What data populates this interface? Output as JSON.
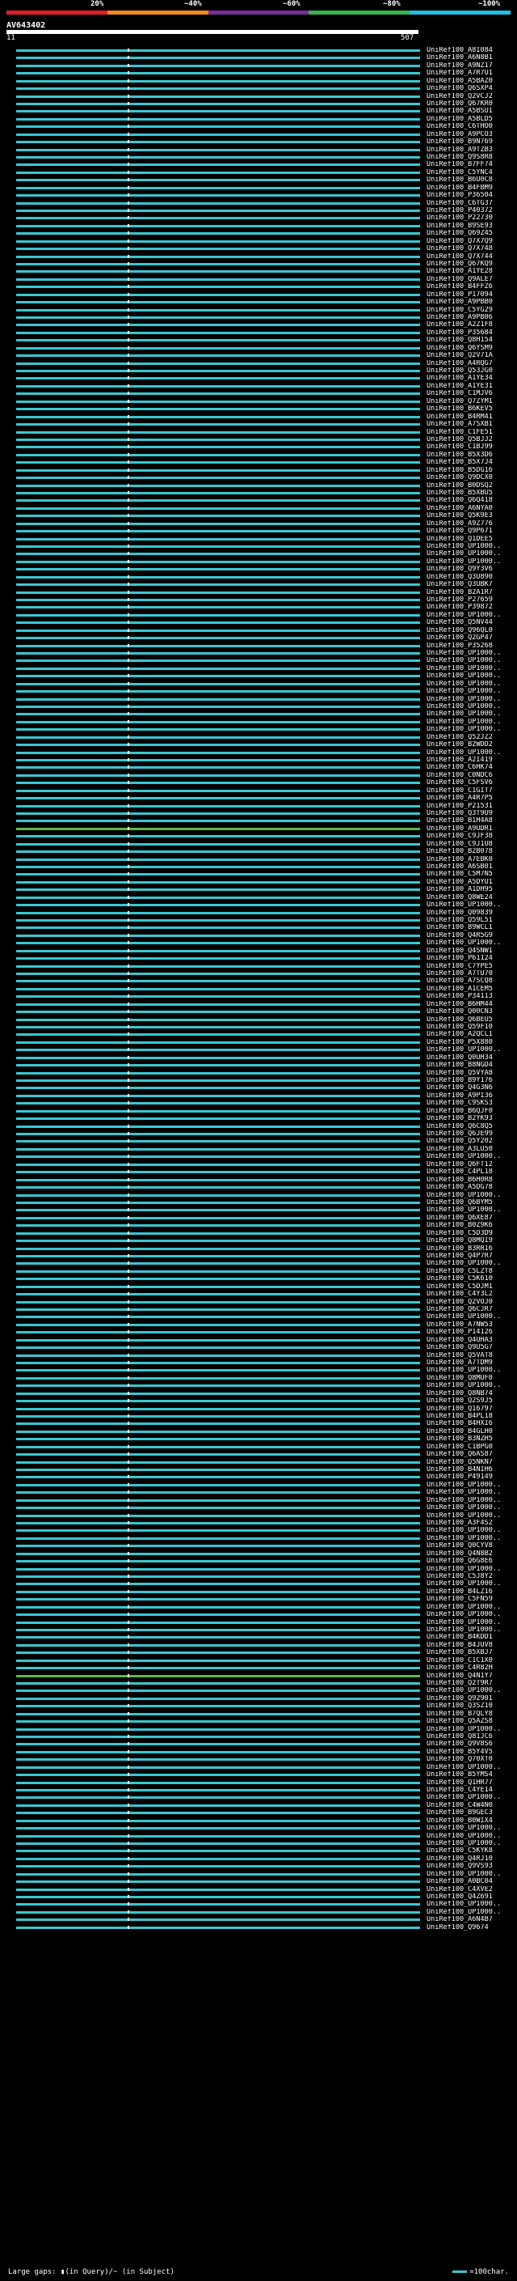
{
  "header": {
    "query_id": "AV643402",
    "start": "11",
    "end": "507",
    "scale_labels": [
      "20%",
      "~40%",
      "~60%",
      "~80%",
      "~100%"
    ],
    "scale_colors": [
      "#e51e25",
      "#f08a1a",
      "#7a2c9a",
      "#37b34a",
      "#1fc0e3"
    ]
  },
  "hits": [
    "UniRef100_A8I084",
    "UniRef100_A6N8B1",
    "UniRef100_A9NZ17",
    "UniRef100_A7R7U1",
    "UniRef100_A5BAZ0",
    "UniRef100_Q6SXP4",
    "UniRef100_Q2VCJ2",
    "UniRef100_Q67KR0",
    "UniRef100_A5BSU1",
    "UniRef100_A5BLD5",
    "UniRef100_C6THO0",
    "UniRef100_A9PCO3",
    "UniRef100_B9N769",
    "UniRef100_A9TZB3",
    "UniRef100_Q9S8R8",
    "UniRef100_B7FF74",
    "UniRef100_C5YNC4",
    "UniRef100_B6U0C8",
    "UniRef100_B4FBM9",
    "UniRef100_P36504",
    "UniRef100_C6TG37",
    "UniRef100_P40372",
    "UniRef100_P22730",
    "UniRef100_B9SE93",
    "UniRef100_Q69Z45",
    "UniRef100_Q7X7Q9",
    "UniRef100_Q7X748",
    "UniRef100_Q7X744",
    "UniRef100_Q67KQ9",
    "UniRef100_A1YE28",
    "UniRef100_Q9ALE7",
    "UniRef100_B4FFZ6",
    "UniRef100_P17094",
    "UniRef100_A9PBB0",
    "UniRef100_C5YG29",
    "UniRef100_A9PB06",
    "UniRef100_A2Z1F8",
    "UniRef100_P35684",
    "UniRef100_Q8H154",
    "UniRef100_Q6YSM9",
    "UniRef100_Q2V71A",
    "UniRef100_A4RQG7",
    "UniRef100_Q53JG0",
    "UniRef100_A1YE34",
    "UniRef100_A1YE31",
    "UniRef100_C1MJV6",
    "UniRef100_Q7ZYM1",
    "UniRef100_B6KEV5",
    "UniRef100_B4RM41",
    "UniRef100_A7SXB1",
    "UniRef100_C1FE51",
    "UniRef100_Q5BJJ2",
    "UniRef100_C1BJ99",
    "UniRef100_B5X3D6",
    "UniRef100_B5X7J4",
    "UniRef100_B5DG16",
    "UniRef100_Q9DCX0",
    "UniRef100_B0DSQ2",
    "UniRef100_B5XBU5",
    "UniRef100_Q6Q418",
    "UniRef100_A6NYA0",
    "UniRef100_Q5K9E3",
    "UniRef100_A9Z776",
    "UniRef100_Q9P671",
    "UniRef100_Q1DEE5",
    "UniRef100_UP1000..",
    "UniRef100_UP1000..",
    "UniRef100_UP1000..",
    "UniRef100_Q9Y3V6",
    "UniRef100_Q3U890",
    "UniRef100_Q3UBK7",
    "UniRef100_B2A1R7",
    "UniRef100_P27659",
    "UniRef100_P39872",
    "UniRef100_UP1000..",
    "UniRef100_Q5NV44",
    "UniRef100_Q96QL0",
    "UniRef100_Q2GP47",
    "UniRef100_P35268",
    "UniRef100_UP1000..",
    "UniRef100_UP1000..",
    "UniRef100_UP1000..",
    "UniRef100_UP1000..",
    "UniRef100_UP1000..",
    "UniRef100_UP1000..",
    "UniRef100_UP1000..",
    "UniRef100_UP1000..",
    "UniRef100_UP1000..",
    "UniRef100_UP1000..",
    "UniRef100_UP1000..",
    "UniRef100_Q52JZ2",
    "UniRef100_B2WDD2",
    "UniRef100_UP1000..",
    "UniRef100_A2I419",
    "UniRef100_C6HK74",
    "UniRef100_C0NDC6",
    "UniRef100_C5FSV6",
    "UniRef100_C1GIT7",
    "UniRef100_A4R7P5",
    "UniRef100_P21531",
    "UniRef100_Q3T9U9",
    "UniRef100_B1H4A8",
    "UniRef100_A9UDR1",
    "UniRef100_C9JF38",
    "UniRef100_C9J1U8",
    "UniRef100_B2B078",
    "UniRef100_A7EBK0",
    "UniRef100_A6SB01",
    "UniRef100_C5M7N5",
    "UniRef100_A5DYU1",
    "UniRef100_A1DH95",
    "UniRef100_Q8WE24",
    "UniRef100_UP1000..",
    "UniRef100_Q09839",
    "UniRef100_Q59L51",
    "UniRef100_B9WCL1",
    "UniRef100_Q4R5G9",
    "UniRef100_UP1000..",
    "UniRef100_Q4SNW1",
    "UniRef100_P61124",
    "UniRef100_C7YPE5",
    "UniRef100_A7TU70",
    "UniRef100_A7SCQ8",
    "UniRef100_A1CEM5",
    "UniRef100_P34113",
    "UniRef100_B6HM44",
    "UniRef100_Q00CN3",
    "UniRef100_Q6BEU5",
    "UniRef100_Q59F10",
    "UniRef100_A2QCL1",
    "UniRef100_P5X880",
    "UniRef100_UP1000..",
    "UniRef100_Q0UH34",
    "UniRef100_B8NGD4",
    "UniRef100_Q5VYA8",
    "UniRef100_B9Y176",
    "UniRef100_Q4G3N6",
    "UniRef100_A9PI36",
    "UniRef100_C9SKS3",
    "UniRef100_B6QJF0",
    "UniRef100_B2YK93",
    "UniRef100_Q6C8Q5",
    "UniRef100_Q6JE99",
    "UniRef100_Q5Y202",
    "UniRef100_A3LU50",
    "UniRef100_UP1000..",
    "UniRef100_Q6FT12",
    "UniRef100_C4PL18",
    "UniRef100_B6H0R8",
    "UniRef100_A5DG78",
    "UniRef100_UP1000..",
    "UniRef100_Q6BYM5",
    "UniRef100_UP1000..",
    "UniRef100_Q6XE87",
    "UniRef100_B0Z9K6",
    "UniRef100_C5D3D9",
    "UniRef100_Q8MQI9",
    "UniRef100_B3RR16",
    "UniRef100_Q4P7R7",
    "UniRef100_UP1000..",
    "UniRef100_C5LZT8",
    "UniRef100_C5K610",
    "UniRef100_C5DJM1",
    "UniRef100_C4Y3L2",
    "UniRef100_Q2VOJ0",
    "UniRef100_Q6CJR7",
    "UniRef100_UP1000..",
    "UniRef100_A7NW53",
    "UniRef100_P14126",
    "UniRef100_Q4UHA3",
    "UniRef100_Q9U5G7",
    "UniRef100_Q5VAT8",
    "UniRef100_A7TDM9",
    "UniRef100_UP1000..",
    "UniRef100_Q8MUF0",
    "UniRef100_UP1000..",
    "UniRef100_Q8NB74",
    "UniRef100_Q2S9J5",
    "UniRef100_Q16797",
    "UniRef100_B4PL18",
    "UniRef100_B4HXI6",
    "UniRef100_B4GLH0",
    "UniRef100_B3NZH5",
    "UniRef100_C1BPG0",
    "UniRef100_Q6AS87",
    "UniRef100_Q5NKN7",
    "UniRef100_B4NIH6",
    "UniRef100_P49149",
    "UniRef100_UP1000..",
    "UniRef100_UP1000..",
    "UniRef100_UP1000..",
    "UniRef100_UP1000..",
    "UniRef100_UP1000..",
    "UniRef100_A3F4S2",
    "UniRef100_UP1000..",
    "UniRef100_UP1000..",
    "UniRef100_Q0CYV8",
    "UniRef100_Q4N8B2",
    "UniRef100_Q6G8E6",
    "UniRef100_UP1000..",
    "UniRef100_C5J8Y2",
    "UniRef100_UP1000..",
    "UniRef100_B4LZ16",
    "UniRef100_C5FN59",
    "UniRef100_UP1000..",
    "UniRef100_UP1000..",
    "UniRef100_UP1000..",
    "UniRef100_UP1000..",
    "UniRef100_B4KDD1",
    "UniRef100_B4JUV8",
    "UniRef100_B5XBJ7",
    "UniRef100_C1C1X0",
    "UniRef100_C4R82H",
    "UniRef100_Q4N1Y7",
    "UniRef100_Q2T9R7",
    "UniRef100_UP1000..",
    "UniRef100_Q92901",
    "UniRef100_Q3SZ10",
    "UniRef100_B7QLY8",
    "UniRef100_Q5AZS8",
    "UniRef100_UP1000..",
    "UniRef100_Q81JC6",
    "UniRef100_Q9V8S6",
    "UniRef100_B5Y4V5",
    "UniRef100_Q70XT0",
    "UniRef100_UP1000..",
    "UniRef100_B5YMS4",
    "UniRef100_Q1HR77",
    "UniRef100_C4YE14",
    "UniRef100_UP1000..",
    "UniRef100_C4W4N0",
    "UniRef100_B9GEC3",
    "UniRef100_B0WIX4",
    "UniRef100_UP1000..",
    "UniRef100_UP1000..",
    "UniRef100_UP1000..",
    "UniRef100_C5KYK8",
    "UniRef100_Q4RJ10",
    "UniRef100_Q9VS93",
    "UniRef100_UP1000..",
    "UniRef100_A0BC04",
    "UniRef100_C4XVE2",
    "UniRef100_Q4Z691",
    "UniRef100_UP1000..",
    "UniRef100_UP1000..",
    "UniRef100_A6N4B7",
    "UniRef100_Q9674"
  ],
  "footer": {
    "left": "Large gaps: ▮(in Query)/~ (in Subject)",
    "right": "=100char."
  }
}
